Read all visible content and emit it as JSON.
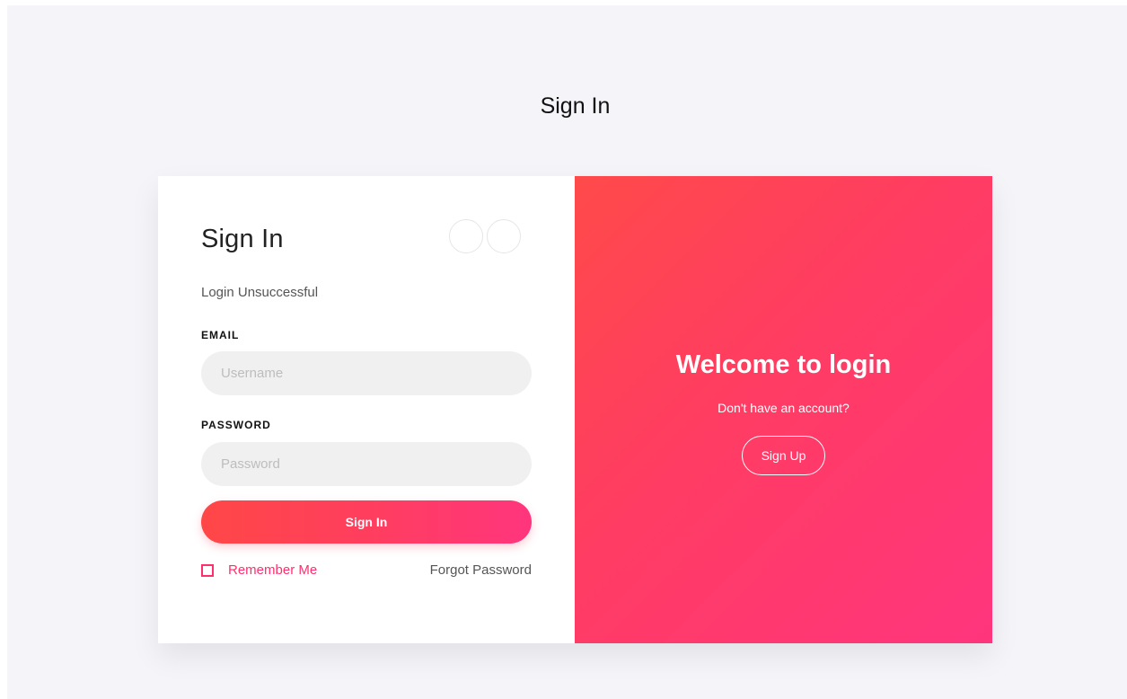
{
  "page": {
    "title": "Sign In"
  },
  "form": {
    "title": "Sign In",
    "status_message": "Login Unsuccessful",
    "email_label": "EMAIL",
    "email_placeholder": "Username",
    "password_label": "PASSWORD",
    "password_placeholder": "Password",
    "submit_label": "Sign In",
    "remember_label": "Remember Me",
    "remember_checked": false,
    "forgot_label": "Forgot Password"
  },
  "promo": {
    "heading": "Welcome to login",
    "subtext": "Don't have an account?",
    "signup_label": "Sign Up"
  },
  "colors": {
    "accent": "#ff2f6e",
    "gradient_start": "#ff4a4a",
    "gradient_end": "#ff357d",
    "background": "#f5f5f9"
  }
}
